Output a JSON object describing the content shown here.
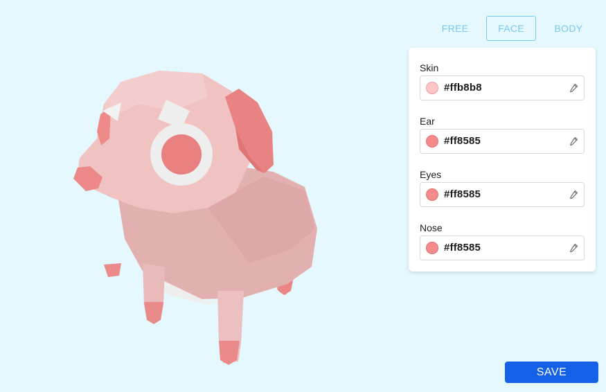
{
  "tabs": [
    {
      "label": "FREE",
      "active": false
    },
    {
      "label": "FACE",
      "active": true
    },
    {
      "label": "BODY",
      "active": false
    }
  ],
  "fields": [
    {
      "label": "Skin",
      "value": "#ffb8b8",
      "swatch": "#ffc4c4"
    },
    {
      "label": "Ear",
      "value": "#ff8585",
      "swatch": "#f58a8a"
    },
    {
      "label": "Eyes",
      "value": "#ff8585",
      "swatch": "#f58a8a"
    },
    {
      "label": "Nose",
      "value": "#ff8585",
      "swatch": "#f58a8a"
    }
  ],
  "save_label": "SAVE",
  "colors": {
    "background": "#e4f8fe",
    "accent": "#79c8ee",
    "save": "#1460e6",
    "skin": "#ffb8b8",
    "feature": "#ff8585"
  },
  "icons": {
    "picker": "eyedropper-icon"
  }
}
